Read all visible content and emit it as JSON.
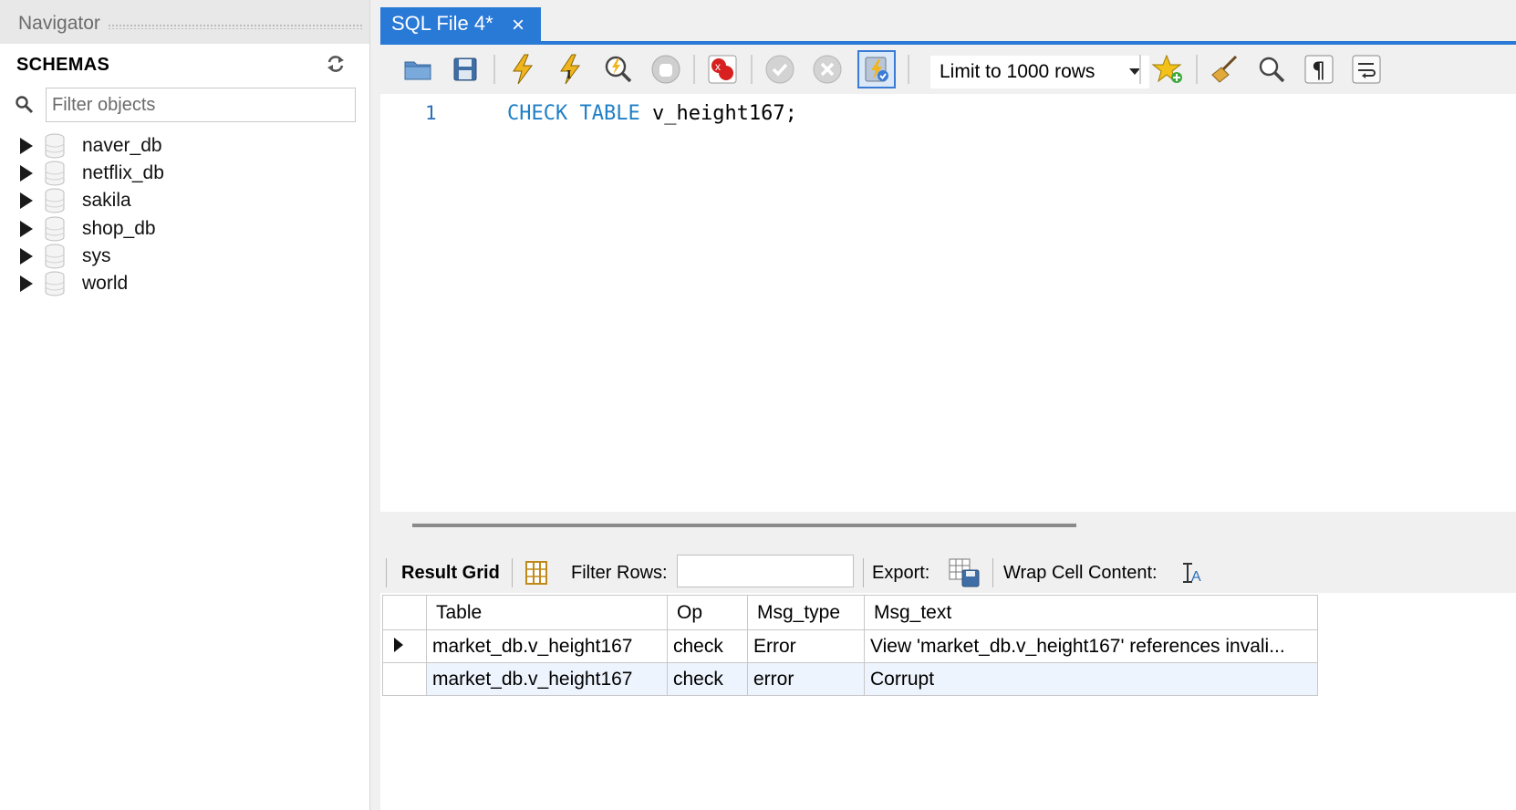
{
  "navigator": {
    "title": "Navigator",
    "schemas_label": "SCHEMAS",
    "filter_placeholder": "Filter objects",
    "schemas": [
      "naver_db",
      "netflix_db",
      "sakila",
      "shop_db",
      "sys",
      "world"
    ]
  },
  "tab": {
    "label": "SQL File 4*",
    "close": "×"
  },
  "toolbar": {
    "limit_label": "Limit to 1000 rows"
  },
  "editor": {
    "line_number": "1",
    "keyword1": "CHECK",
    "keyword2": "TABLE",
    "rest": "v_height167;"
  },
  "result_toolbar": {
    "result_grid_label": "Result Grid",
    "filter_rows_label": "Filter Rows:",
    "export_label": "Export:",
    "wrap_label": "Wrap Cell Content:"
  },
  "grid": {
    "columns": [
      "Table",
      "Op",
      "Msg_type",
      "Msg_text"
    ],
    "rows": [
      [
        "market_db.v_height167",
        "check",
        "Error",
        "View 'market_db.v_height167' references invali..."
      ],
      [
        "market_db.v_height167",
        "check",
        "error",
        "Corrupt"
      ]
    ]
  },
  "colors": {
    "accent": "#2979d6",
    "keyword": "#1f7fc7",
    "row_alt": "#eef4fd"
  }
}
